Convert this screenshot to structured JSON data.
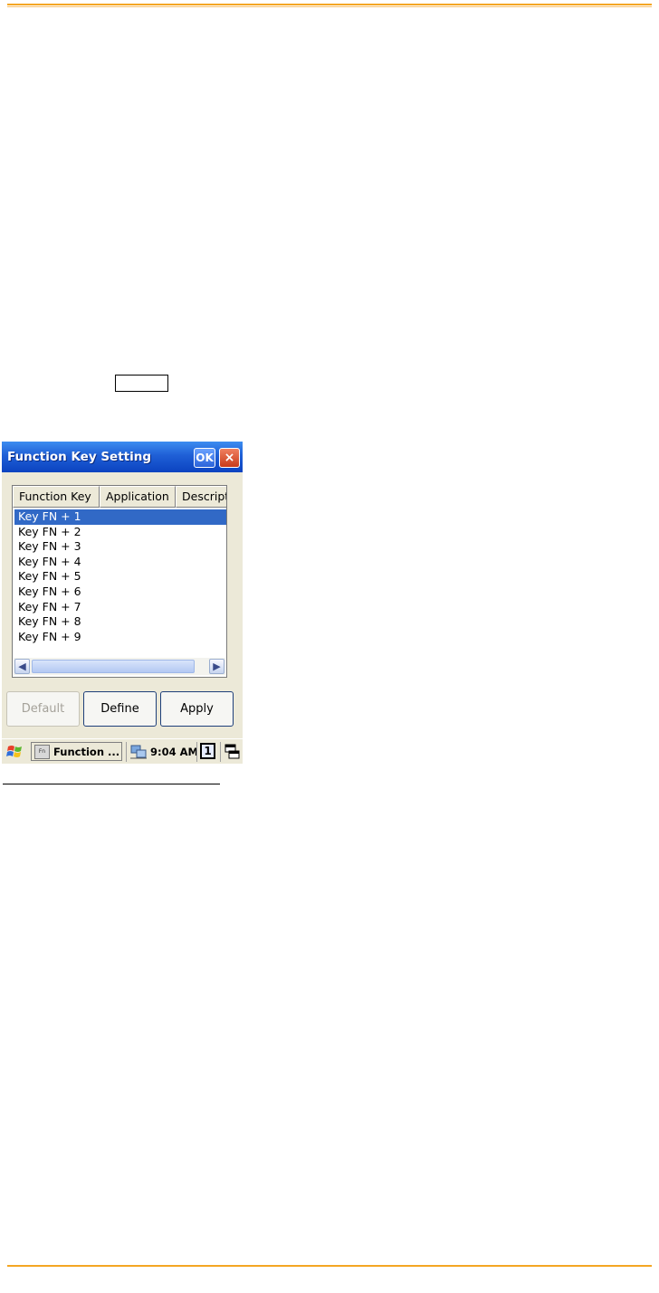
{
  "window": {
    "title": "Function Key Setting",
    "ok_label": "OK",
    "close_label": "×"
  },
  "listview": {
    "columns": [
      "Function Key",
      "Application",
      "Descripti"
    ],
    "rows": [
      "Key FN + 1",
      "Key FN + 2",
      "Key FN + 3",
      "Key FN + 4",
      "Key FN + 5",
      "Key FN + 6",
      "Key FN + 7",
      "Key FN + 8",
      "Key FN + 9"
    ],
    "selected_index": 0
  },
  "buttons": {
    "default": "Default",
    "define": "Define",
    "apply": "Apply"
  },
  "taskbar": {
    "task_label": "Function ...",
    "task_icon_text": "Fn",
    "clock": "9:04 AM",
    "input_indicator": "1"
  },
  "colors": {
    "accent_rule": "#f4a623",
    "titlebar": "#1f5fd6",
    "selection": "#3169c6"
  }
}
